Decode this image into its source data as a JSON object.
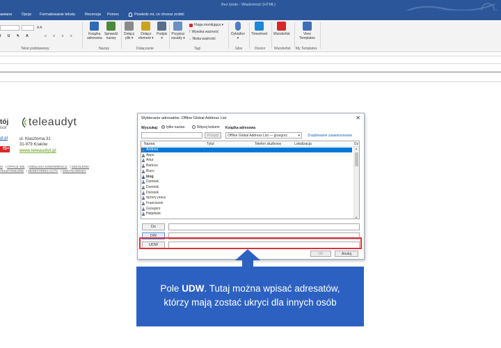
{
  "window": {
    "title": "Bez tytułu - Wiadomość (HTML)"
  },
  "menu": {
    "tabs": [
      "awiane",
      "Opcje",
      "Formatowanie tekstu",
      "Recenzja",
      "Pomoc"
    ],
    "tell_me": "Powiedz mi, co chcesz zrobić"
  },
  "ribbon": {
    "groups": {
      "basic_text": "Tekst podstawowy",
      "names": "Nazwy",
      "include": "Dołączanie",
      "tags": "Tagi",
      "voice": "Głos",
      "dovico": "Dovico",
      "wunderlist": "Wunderlist",
      "templates": "My Templates"
    },
    "buttons": {
      "address_book": [
        "Książka",
        "adresowa"
      ],
      "check_names": [
        "Sprawdź",
        "nazwy"
      ],
      "attach_file": [
        "Dołącz",
        "plik ▾"
      ],
      "attach_item": [
        "Dołącz",
        "element ▾"
      ],
      "signature": [
        "Podpis",
        "▾"
      ],
      "assign_policy": [
        "Przypisz",
        "zasady ▾"
      ],
      "dictate": [
        "Dyktafon",
        "▾"
      ],
      "timesheet": "Timesheet",
      "wunderlist": "Wunderlist",
      "view_templates": [
        "View",
        "Templates"
      ]
    },
    "tags": {
      "flag": "Flaga monitująca ▾",
      "high": "Wysoka ważność",
      "low": "Niska ważność"
    },
    "colors": {
      "accent": "#2b579a"
    }
  },
  "signature": {
    "name": "tój",
    "role": "isor",
    "link": "yt.pl",
    "red_badge": "fS+",
    "logo_text": "teleaudyt",
    "address_line1": "ul. Klasztorna 31",
    "address_line2": "31-979 Kraków",
    "website": "www.teleaudyt.pl",
    "links_row1": [
      "M",
      "OFFICE 365",
      "OBSŁUGA KONFERENCJI",
      "SZKOLENIA"
    ],
    "links_row2": [
      "TELEFONICZNE",
      "MONITORING CCTV",
      "ŚWIATŁOWODY"
    ]
  },
  "dialog": {
    "title": "Wybieranie adresatów: Offline Global Address List",
    "close": "✕",
    "search_label": "Wyszukaj:",
    "radio_name_only": "tylko nazwa",
    "radio_more_columns": "Więcej kolumn",
    "address_book_label": "Książka adresowa",
    "go_button": "Przejdź",
    "address_book_value": "Offline Global Address List — grzegorz",
    "advanced_search": "Znajdowanie zaawansowane",
    "columns": [
      "Nazwa",
      "Tytuł",
      "Telefon służbowy",
      "Lokalizacja",
      "Dz"
    ],
    "rows": [
      {
        "name": "Andrzej",
        "selected": true,
        "group": false
      },
      {
        "name": "Apps",
        "selected": false,
        "group": false
      },
      {
        "name": "Artur",
        "selected": false,
        "group": false
      },
      {
        "name": "Bartosz",
        "selected": false,
        "group": false
      },
      {
        "name": "Biuro",
        "selected": false,
        "group": false
      },
      {
        "name": "blog",
        "selected": false,
        "group": true
      },
      {
        "name": "Dominik",
        "selected": false,
        "group": false
      },
      {
        "name": "Dominik",
        "selected": false,
        "group": false
      },
      {
        "name": "Dominik",
        "selected": false,
        "group": false
      },
      {
        "name": "dyżury pracy",
        "selected": false,
        "group": false
      },
      {
        "name": "Franciszek",
        "selected": false,
        "group": false
      },
      {
        "name": "Grzegorz",
        "selected": false,
        "group": false
      },
      {
        "name": "Helpdesk",
        "selected": false,
        "group": false
      }
    ],
    "to_button": "Do",
    "cc_button": "DW",
    "bcc_button": "UDW",
    "ok_button": "OK",
    "cancel_button": "Anuluj"
  },
  "callout": {
    "prefix": "Pole ",
    "bold": "UDW",
    "line1_rest": ". Tutaj można wpisać adresatów,",
    "line2": "którzy mają zostać ukryci dla innych osób",
    "colors": {
      "background": "#2d61c1",
      "highlight": "#e0303a"
    }
  }
}
